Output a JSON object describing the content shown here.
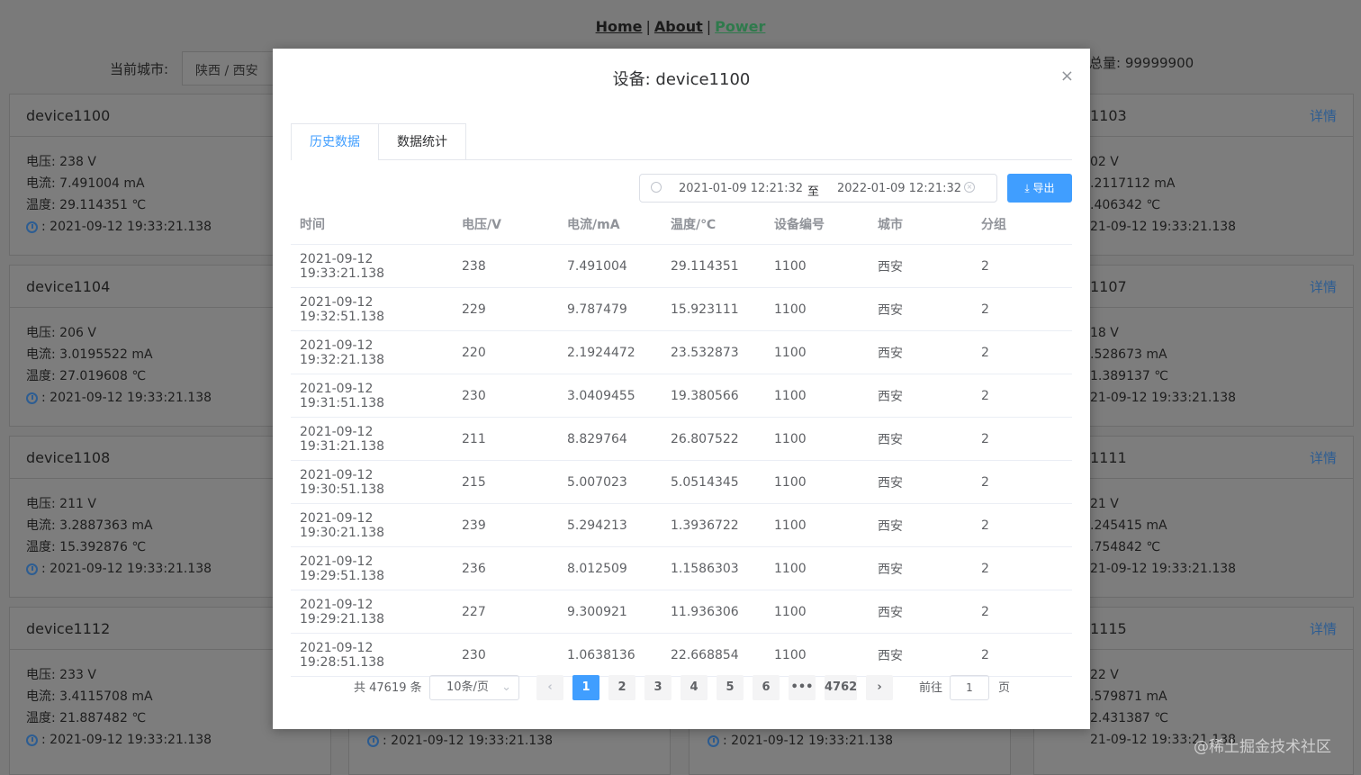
{
  "nav": {
    "home": "Home",
    "about": "About",
    "power": "Power",
    "sep": "|"
  },
  "filters": {
    "city_label": "当前城市:",
    "city_value": "陕西 / 西安",
    "total_text": "总量: 99999900"
  },
  "cards": [
    {
      "title": "device1100",
      "voltage": "电压: 238 V",
      "current": "电流: 7.491004 mA",
      "temp": "温度: 29.114351 ℃",
      "time": ": 2021-09-12 19:33:21.138"
    },
    {
      "title": "device1104",
      "voltage": "电压: 206 V",
      "current": "电流: 3.0195522 mA",
      "temp": "温度: 27.019608 ℃",
      "time": ": 2021-09-12 19:33:21.138"
    },
    {
      "title": "device1108",
      "voltage": "电压: 211 V",
      "current": "电流: 3.2887363 mA",
      "temp": "温度: 15.392876 ℃",
      "time": ": 2021-09-12 19:33:21.138"
    },
    {
      "title": "device1112",
      "voltage": "电压: 233 V",
      "current": "电流: 3.4115708 mA",
      "temp": "温度: 21.887482 ℃",
      "time": ": 2021-09-12 19:33:21.138"
    },
    {
      "title": "1103",
      "link": "详情",
      "voltage": "02 V",
      "current": ".2117112 mA",
      "temp": ".406342 ℃",
      "time": "21-09-12 19:33:21.138"
    },
    {
      "title": "1107",
      "link": "详情",
      "voltage": "18 V",
      "current": ".528673 mA",
      "temp": "1.389137 ℃",
      "time": "21-09-12 19:33:21.138"
    },
    {
      "title": "1111",
      "link": "详情",
      "voltage": "21 V",
      "current": ".245415 mA",
      "temp": ".754842 ℃",
      "time": "21-09-12 19:33:21.138"
    },
    {
      "title": "1115",
      "link": "详情",
      "voltage": "22 V",
      "current": ".579871 mA",
      "temp": "2.431387 ℃",
      "time": "21-09-12 19:33:21.138"
    }
  ],
  "bottom_times": [
    ": 2021-09-12 19:33:21.138",
    ": 2021-09-12 19:33:21.138"
  ],
  "watermark": "@稀土掘金技术社区",
  "dialog": {
    "title": "设备: device1100",
    "close": "×",
    "tabs": [
      "历史数据",
      "数据统计"
    ],
    "date_start": "2021-01-09 12:21:32",
    "date_to": "至",
    "date_end": "2022-01-09 12:21:32",
    "export_label": "导出",
    "columns": [
      "时间",
      "电压/V",
      "电流/mA",
      "温度/℃",
      "设备编号",
      "城市",
      "分组"
    ],
    "rows": [
      [
        "2021-09-12 19:33:21.138",
        "238",
        "7.491004",
        "29.114351",
        "1100",
        "西安",
        "2"
      ],
      [
        "2021-09-12 19:32:51.138",
        "229",
        "9.787479",
        "15.923111",
        "1100",
        "西安",
        "2"
      ],
      [
        "2021-09-12 19:32:21.138",
        "220",
        "2.1924472",
        "23.532873",
        "1100",
        "西安",
        "2"
      ],
      [
        "2021-09-12 19:31:51.138",
        "230",
        "3.0409455",
        "19.380566",
        "1100",
        "西安",
        "2"
      ],
      [
        "2021-09-12 19:31:21.138",
        "211",
        "8.829764",
        "26.807522",
        "1100",
        "西安",
        "2"
      ],
      [
        "2021-09-12 19:30:51.138",
        "215",
        "5.007023",
        "5.0514345",
        "1100",
        "西安",
        "2"
      ],
      [
        "2021-09-12 19:30:21.138",
        "239",
        "5.294213",
        "1.3936722",
        "1100",
        "西安",
        "2"
      ],
      [
        "2021-09-12 19:29:51.138",
        "236",
        "8.012509",
        "1.1586303",
        "1100",
        "西安",
        "2"
      ],
      [
        "2021-09-12 19:29:21.138",
        "227",
        "9.300921",
        "11.936306",
        "1100",
        "西安",
        "2"
      ],
      [
        "2021-09-12 19:28:51.138",
        "230",
        "1.0638136",
        "22.668854",
        "1100",
        "西安",
        "2"
      ]
    ],
    "pager": {
      "total": "共 47619 条",
      "page_size": "10条/页",
      "prev": "‹",
      "pages": [
        "1",
        "2",
        "3",
        "4",
        "5",
        "6",
        "•••",
        "4762"
      ],
      "current": "1",
      "next": "›",
      "goto_label": "前往",
      "goto_value": "1",
      "goto_unit": "页"
    }
  }
}
